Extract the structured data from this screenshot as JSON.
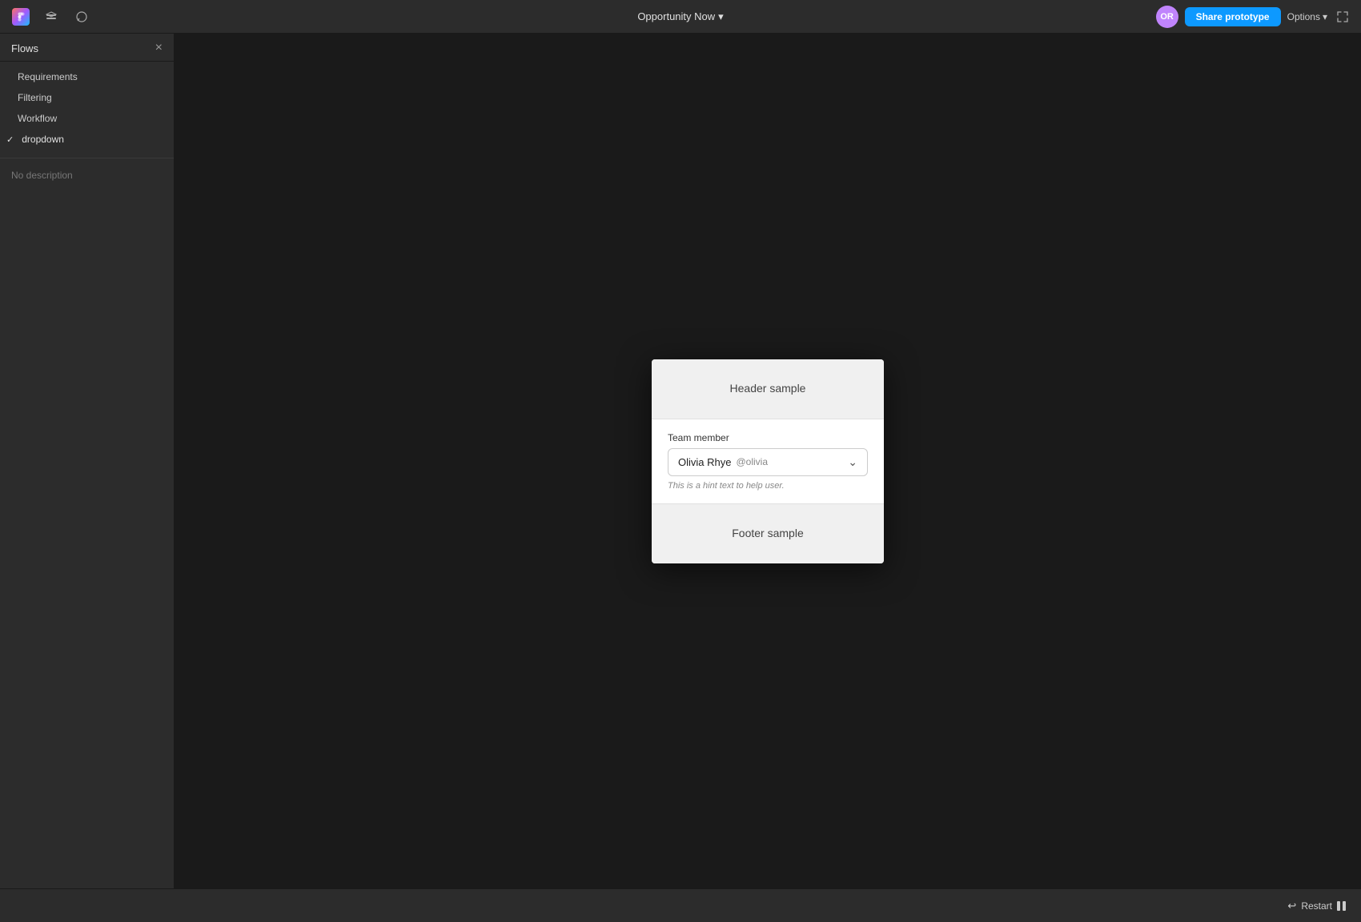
{
  "topbar": {
    "title": "Opportunity Now",
    "chevron": "▾",
    "share_label": "Share prototype",
    "options_label": "Options",
    "options_chevron": "▾",
    "avatar_initials": "OR"
  },
  "sidebar": {
    "title": "Flows",
    "close_label": "×",
    "flows": [
      {
        "label": "Requirements",
        "active": false
      },
      {
        "label": "Filtering",
        "active": false
      },
      {
        "label": "Workflow",
        "active": false
      },
      {
        "label": "dropdown",
        "active": true
      }
    ],
    "description": "No description"
  },
  "card": {
    "header_label": "Header sample",
    "field_label": "Team member",
    "dropdown_main": "Olivia Rhye",
    "dropdown_sub": "@olivia",
    "hint_text": "This is a hint text to help user.",
    "footer_label": "Footer sample"
  },
  "bottombar": {
    "restart_label": "Restart"
  }
}
